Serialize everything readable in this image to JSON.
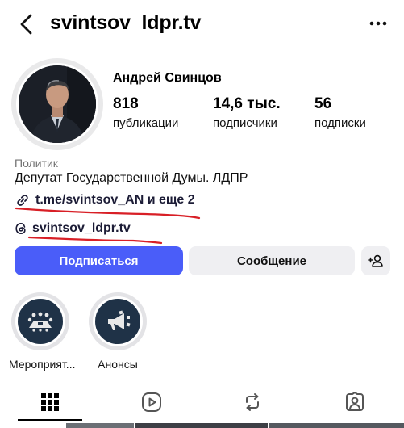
{
  "header": {
    "username": "svintsov_ldpr.tv",
    "back_icon": "chevron-left-icon",
    "more_icon": "more-dots-icon"
  },
  "profile": {
    "display_name": "Андрей Свинцов",
    "stats": [
      {
        "value": "818",
        "label": "публикации"
      },
      {
        "value": "14,6 тыс.",
        "label": "подписчики"
      },
      {
        "value": "56",
        "label": "подписки"
      }
    ],
    "category": "Политик",
    "bio": "Депутат Государственной Думы. ЛДПР",
    "link_text": "t.me/svintsov_AN и еще 2",
    "threads_handle": "svintsov_ldpr.tv",
    "annotation_color": "#d81f26"
  },
  "actions": {
    "follow_label": "Подписаться",
    "message_label": "Сообщение",
    "follow_color": "#4a5df9"
  },
  "highlights": [
    {
      "label": "Мероприят...",
      "icon": "meeting-table-icon"
    },
    {
      "label": "Анонсы",
      "icon": "megaphone-icon"
    }
  ],
  "tabs": [
    {
      "name": "grid",
      "icon": "grid-icon",
      "active": true
    },
    {
      "name": "reels",
      "icon": "reels-icon",
      "active": false
    },
    {
      "name": "reposts",
      "icon": "repost-icon",
      "active": false
    },
    {
      "name": "tagged",
      "icon": "tagged-icon",
      "active": false
    }
  ]
}
